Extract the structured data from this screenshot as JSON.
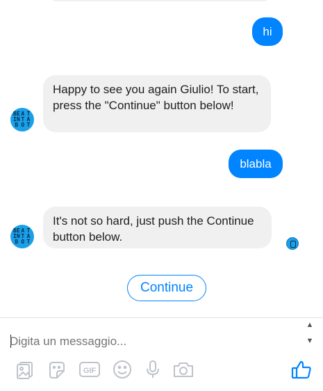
{
  "messages": [
    {
      "from": "user",
      "text": "hi"
    },
    {
      "from": "bot",
      "text": "Happy to see you again Giulio! To start, press the \"Continue\" button below!"
    },
    {
      "from": "user",
      "text": "blabla"
    },
    {
      "from": "bot",
      "text": "It's not so hard, just push the Continue button below."
    }
  ],
  "bot_avatar": {
    "letters": [
      "BE",
      "A",
      "T",
      "IN",
      "T",
      "A",
      "B",
      "O",
      "T"
    ]
  },
  "quick_reply": {
    "label": "Continue"
  },
  "composer": {
    "placeholder": "Digita un messaggio..."
  },
  "toolbar": {
    "icons": [
      "photo-icon",
      "sticker-icon",
      "gif-icon",
      "emoji-icon",
      "microphone-icon",
      "camera-icon",
      "like-icon"
    ],
    "gif_label": "GIF"
  },
  "colors": {
    "accent": "#0084ff",
    "incoming_bubble": "#f1f0f0",
    "avatar": "#1aa0e8",
    "icon": "#bec2c9"
  }
}
